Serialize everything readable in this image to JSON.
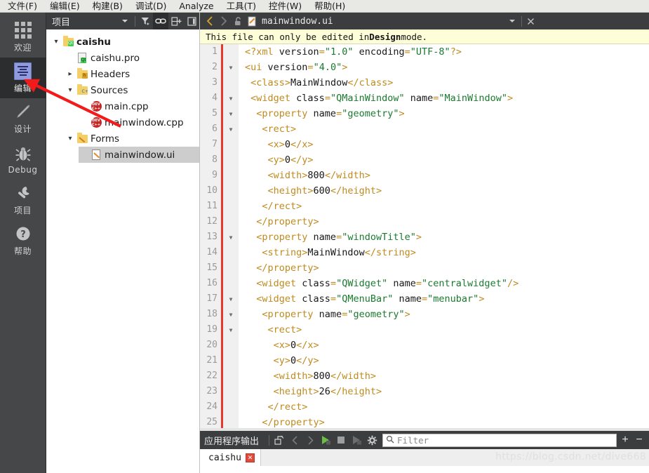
{
  "menubar": {
    "items": [
      {
        "label": "文件(F)",
        "name": "menu-file"
      },
      {
        "label": "编辑(E)",
        "name": "menu-edit"
      },
      {
        "label": "构建(B)",
        "name": "menu-build"
      },
      {
        "label": "调试(D)",
        "name": "menu-debug"
      },
      {
        "label": "Analyze",
        "name": "menu-analyze"
      },
      {
        "label": "工具(T)",
        "name": "menu-tools"
      },
      {
        "label": "控件(W)",
        "name": "menu-window"
      },
      {
        "label": "帮助(H)",
        "name": "menu-help"
      }
    ]
  },
  "modebar": {
    "items": [
      {
        "label": "欢迎",
        "icon": "grid-icon",
        "active": false
      },
      {
        "label": "编辑",
        "icon": "edit-document-icon",
        "active": true
      },
      {
        "label": "设计",
        "icon": "pencil-icon",
        "active": false
      },
      {
        "label": "Debug",
        "icon": "bug-icon",
        "active": false
      },
      {
        "label": "项目",
        "icon": "wrench-icon",
        "active": false
      },
      {
        "label": "帮助",
        "icon": "question-mark-icon",
        "active": false
      }
    ]
  },
  "project_panel": {
    "title": "项目",
    "toolbar": [
      {
        "name": "chevron-down-icon",
        "active": false
      },
      {
        "name": "filter-icon",
        "active": false
      },
      {
        "name": "link-sync-icon",
        "active": true
      },
      {
        "name": "split-add-icon",
        "active": false
      },
      {
        "name": "collapse-sidebar-icon",
        "active": false
      }
    ],
    "tree": [
      {
        "label": "caishu",
        "icon": "qt-project-folder-icon",
        "indent": 0,
        "arrow": "expanded",
        "bold": true,
        "selected": false
      },
      {
        "label": "caishu.pro",
        "icon": "qt-pro-file-icon",
        "indent": 1,
        "arrow": "none",
        "bold": false,
        "selected": false
      },
      {
        "label": "Headers",
        "icon": "headers-folder-icon",
        "indent": 1,
        "arrow": "collapsed",
        "bold": false,
        "selected": false
      },
      {
        "label": "Sources",
        "icon": "sources-folder-icon",
        "indent": 1,
        "arrow": "expanded",
        "bold": false,
        "selected": false
      },
      {
        "label": "main.cpp",
        "icon": "cpp-file-icon",
        "indent": 2,
        "arrow": "none",
        "bold": false,
        "selected": false
      },
      {
        "label": "mainwindow.cpp",
        "icon": "cpp-file-icon",
        "indent": 2,
        "arrow": "none",
        "bold": false,
        "selected": false
      },
      {
        "label": "Forms",
        "icon": "forms-folder-icon",
        "indent": 1,
        "arrow": "expanded",
        "bold": false,
        "selected": false
      },
      {
        "label": "mainwindow.ui",
        "icon": "ui-file-icon",
        "indent": 2,
        "arrow": "none",
        "bold": false,
        "selected": true
      }
    ]
  },
  "editor": {
    "tabbar": {
      "back_icon": "back-arrow-icon",
      "forward_icon": "forward-arrow-icon",
      "lock_icon": "unlocked-padlock-icon",
      "file_icon": "ui-file-icon",
      "filename": "mainwindow.ui",
      "dropdown_icon": "chevron-down-icon",
      "close_icon": "close-icon"
    },
    "infobar": {
      "prefix": "This file can only be edited in ",
      "emphasis": "Design",
      "suffix": " mode."
    },
    "lines": [
      {
        "n": 1,
        "fold": false,
        "tokens": [
          {
            "t": "pi",
            "v": "<?xml "
          },
          {
            "t": "attr",
            "v": "version"
          },
          {
            "t": "pi",
            "v": "="
          },
          {
            "t": "val",
            "v": "\"1.0\""
          },
          {
            "t": "pi",
            "v": " "
          },
          {
            "t": "attr",
            "v": "encoding"
          },
          {
            "t": "pi",
            "v": "="
          },
          {
            "t": "val",
            "v": "\"UTF-8\""
          },
          {
            "t": "pi",
            "v": "?>"
          }
        ],
        "indent": 0
      },
      {
        "n": 2,
        "fold": true,
        "tokens": [
          {
            "t": "tag",
            "v": "<ui "
          },
          {
            "t": "attr",
            "v": "version"
          },
          {
            "t": "tag",
            "v": "="
          },
          {
            "t": "val",
            "v": "\"4.0\""
          },
          {
            "t": "tag",
            "v": ">"
          }
        ],
        "indent": 0
      },
      {
        "n": 3,
        "fold": false,
        "tokens": [
          {
            "t": "tag",
            "v": "<class>"
          },
          {
            "t": "txt",
            "v": "MainWindow"
          },
          {
            "t": "tag",
            "v": "</class>"
          }
        ],
        "indent": 1
      },
      {
        "n": 4,
        "fold": true,
        "tokens": [
          {
            "t": "tag",
            "v": "<widget "
          },
          {
            "t": "attr",
            "v": "class"
          },
          {
            "t": "tag",
            "v": "="
          },
          {
            "t": "val",
            "v": "\"QMainWindow\""
          },
          {
            "t": "tag",
            "v": " "
          },
          {
            "t": "attr",
            "v": "name"
          },
          {
            "t": "tag",
            "v": "="
          },
          {
            "t": "val",
            "v": "\"MainWindow\""
          },
          {
            "t": "tag",
            "v": ">"
          }
        ],
        "indent": 1
      },
      {
        "n": 5,
        "fold": true,
        "tokens": [
          {
            "t": "tag",
            "v": "<property "
          },
          {
            "t": "attr",
            "v": "name"
          },
          {
            "t": "tag",
            "v": "="
          },
          {
            "t": "val",
            "v": "\"geometry\""
          },
          {
            "t": "tag",
            "v": ">"
          }
        ],
        "indent": 2
      },
      {
        "n": 6,
        "fold": true,
        "tokens": [
          {
            "t": "tag",
            "v": "<rect>"
          }
        ],
        "indent": 3
      },
      {
        "n": 7,
        "fold": false,
        "tokens": [
          {
            "t": "tag",
            "v": "<x>"
          },
          {
            "t": "txt",
            "v": "0"
          },
          {
            "t": "tag",
            "v": "</x>"
          }
        ],
        "indent": 4
      },
      {
        "n": 8,
        "fold": false,
        "tokens": [
          {
            "t": "tag",
            "v": "<y>"
          },
          {
            "t": "txt",
            "v": "0"
          },
          {
            "t": "tag",
            "v": "</y>"
          }
        ],
        "indent": 4
      },
      {
        "n": 9,
        "fold": false,
        "tokens": [
          {
            "t": "tag",
            "v": "<width>"
          },
          {
            "t": "txt",
            "v": "800"
          },
          {
            "t": "tag",
            "v": "</width>"
          }
        ],
        "indent": 4
      },
      {
        "n": 10,
        "fold": false,
        "tokens": [
          {
            "t": "tag",
            "v": "<height>"
          },
          {
            "t": "txt",
            "v": "600"
          },
          {
            "t": "tag",
            "v": "</height>"
          }
        ],
        "indent": 4
      },
      {
        "n": 11,
        "fold": false,
        "tokens": [
          {
            "t": "tag",
            "v": "</rect>"
          }
        ],
        "indent": 3
      },
      {
        "n": 12,
        "fold": false,
        "tokens": [
          {
            "t": "tag",
            "v": "</property>"
          }
        ],
        "indent": 2
      },
      {
        "n": 13,
        "fold": true,
        "tokens": [
          {
            "t": "tag",
            "v": "<property "
          },
          {
            "t": "attr",
            "v": "name"
          },
          {
            "t": "tag",
            "v": "="
          },
          {
            "t": "val",
            "v": "\"windowTitle\""
          },
          {
            "t": "tag",
            "v": ">"
          }
        ],
        "indent": 2
      },
      {
        "n": 14,
        "fold": false,
        "tokens": [
          {
            "t": "tag",
            "v": "<string>"
          },
          {
            "t": "txt",
            "v": "MainWindow"
          },
          {
            "t": "tag",
            "v": "</string>"
          }
        ],
        "indent": 3
      },
      {
        "n": 15,
        "fold": false,
        "tokens": [
          {
            "t": "tag",
            "v": "</property>"
          }
        ],
        "indent": 2
      },
      {
        "n": 16,
        "fold": false,
        "tokens": [
          {
            "t": "tag",
            "v": "<widget "
          },
          {
            "t": "attr",
            "v": "class"
          },
          {
            "t": "tag",
            "v": "="
          },
          {
            "t": "val",
            "v": "\"QWidget\""
          },
          {
            "t": "tag",
            "v": " "
          },
          {
            "t": "attr",
            "v": "name"
          },
          {
            "t": "tag",
            "v": "="
          },
          {
            "t": "val",
            "v": "\"centralwidget\""
          },
          {
            "t": "tag",
            "v": "/>"
          }
        ],
        "indent": 2
      },
      {
        "n": 17,
        "fold": true,
        "tokens": [
          {
            "t": "tag",
            "v": "<widget "
          },
          {
            "t": "attr",
            "v": "class"
          },
          {
            "t": "tag",
            "v": "="
          },
          {
            "t": "val",
            "v": "\"QMenuBar\""
          },
          {
            "t": "tag",
            "v": " "
          },
          {
            "t": "attr",
            "v": "name"
          },
          {
            "t": "tag",
            "v": "="
          },
          {
            "t": "val",
            "v": "\"menubar\""
          },
          {
            "t": "tag",
            "v": ">"
          }
        ],
        "indent": 2
      },
      {
        "n": 18,
        "fold": true,
        "tokens": [
          {
            "t": "tag",
            "v": "<property "
          },
          {
            "t": "attr",
            "v": "name"
          },
          {
            "t": "tag",
            "v": "="
          },
          {
            "t": "val",
            "v": "\"geometry\""
          },
          {
            "t": "tag",
            "v": ">"
          }
        ],
        "indent": 3
      },
      {
        "n": 19,
        "fold": true,
        "tokens": [
          {
            "t": "tag",
            "v": "<rect>"
          }
        ],
        "indent": 4
      },
      {
        "n": 20,
        "fold": false,
        "tokens": [
          {
            "t": "tag",
            "v": "<x>"
          },
          {
            "t": "txt",
            "v": "0"
          },
          {
            "t": "tag",
            "v": "</x>"
          }
        ],
        "indent": 5
      },
      {
        "n": 21,
        "fold": false,
        "tokens": [
          {
            "t": "tag",
            "v": "<y>"
          },
          {
            "t": "txt",
            "v": "0"
          },
          {
            "t": "tag",
            "v": "</y>"
          }
        ],
        "indent": 5
      },
      {
        "n": 22,
        "fold": false,
        "tokens": [
          {
            "t": "tag",
            "v": "<width>"
          },
          {
            "t": "txt",
            "v": "800"
          },
          {
            "t": "tag",
            "v": "</width>"
          }
        ],
        "indent": 5
      },
      {
        "n": 23,
        "fold": false,
        "tokens": [
          {
            "t": "tag",
            "v": "<height>"
          },
          {
            "t": "txt",
            "v": "26"
          },
          {
            "t": "tag",
            "v": "</height>"
          }
        ],
        "indent": 5
      },
      {
        "n": 24,
        "fold": false,
        "tokens": [
          {
            "t": "tag",
            "v": "</rect>"
          }
        ],
        "indent": 4
      },
      {
        "n": 25,
        "fold": false,
        "tokens": [
          {
            "t": "tag",
            "v": "</property>"
          }
        ],
        "indent": 3
      }
    ]
  },
  "output_pane": {
    "title": "应用程序输出",
    "toolbar": [
      {
        "name": "clear-window-icon"
      },
      {
        "name": "prev-item-icon"
      },
      {
        "name": "next-item-icon"
      },
      {
        "name": "run-icon"
      },
      {
        "name": "stop-icon"
      },
      {
        "name": "rerun-icon"
      },
      {
        "name": "settings-gear-icon"
      }
    ],
    "filter": {
      "placeholder": "Filter",
      "value": "",
      "icon": "search-icon"
    },
    "add_label": "+",
    "remove_label": "−",
    "tabs": [
      {
        "label": "caishu",
        "close_icon": "close-icon"
      }
    ],
    "watermark": "https://blog.csdn.net/dive668"
  },
  "colors": {
    "accent_orange": "#c08a1e",
    "string_green": "#1a7a2e",
    "chrome_dark": "#3c3d3f",
    "modebar": "#464749",
    "selection_grey": "#cdcdcd",
    "info_yellow": "#fdfdd8",
    "modified_red": "#e8372c",
    "annotation_red": "#f21a1a"
  }
}
